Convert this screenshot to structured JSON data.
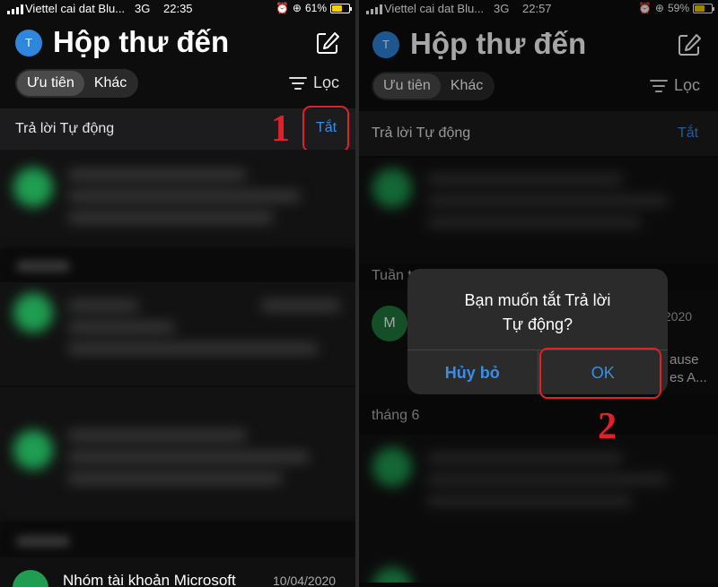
{
  "left": {
    "status": {
      "carrier": "Viettel cai dat Blu...",
      "network": "3G",
      "time": "22:35",
      "battery": "61%",
      "battery_fraction": 0.61
    },
    "avatar": "T",
    "title": "Hộp thư đến",
    "tabs": [
      {
        "label": "Ưu tiên"
      },
      {
        "label": "Khác"
      }
    ],
    "filter_label": "Lọc",
    "auto_reply": {
      "label": "Trả lời Tự động",
      "action": "Tắt"
    },
    "last_mail": {
      "sender": "Nhóm tài khoản Microsoft",
      "date": "10/04/2020"
    },
    "step": "1"
  },
  "right": {
    "status": {
      "carrier": "Viettel cai dat Blu...",
      "network": "3G",
      "time": "22:57",
      "battery": "59%",
      "battery_fraction": 0.59
    },
    "avatar": "T",
    "title": "Hộp thư đến",
    "tabs": [
      {
        "label": "Ưu tiên"
      },
      {
        "label": "Khác"
      }
    ],
    "filter_label": "Lọc",
    "auto_reply": {
      "label": "Trả lời Tự động",
      "action": "Tắt"
    },
    "section_week": "Tuần t",
    "mail_m": {
      "avatar": "M",
      "date": "/2020",
      "snippet1": "ause",
      "snippet2": "es A..."
    },
    "section_month": "tháng 6",
    "dialog": {
      "message_line1": "Bạn muốn tắt Trả lời",
      "message_line2": "Tự động?",
      "cancel": "Hủy bỏ",
      "ok": "OK"
    },
    "step": "2"
  },
  "colors": {
    "accent": "#3a8ee6",
    "highlight": "#e2202a",
    "avatar": "#2e86de"
  }
}
